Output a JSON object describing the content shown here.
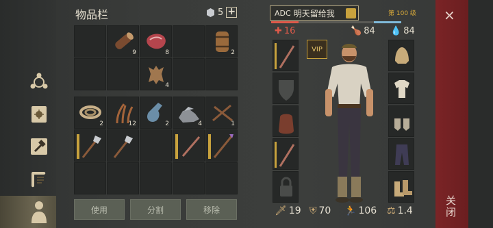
{
  "inventory": {
    "title": "物品栏",
    "coin_count": "5",
    "add_symbol": "+",
    "quantities": {
      "log": "9",
      "meat": "8",
      "barrel": "2",
      "hide": "4",
      "rope": "2",
      "fiber": "12",
      "flask": "2",
      "ore": "4",
      "sticks": "1"
    },
    "buttons": {
      "use": "使用",
      "split": "分割",
      "remove": "移除"
    }
  },
  "character": {
    "name": "明天留给我",
    "tag": "ADC",
    "level": "第 100 级",
    "health": "16",
    "hunger": "84",
    "thirst": "84",
    "vip": "VIP",
    "attack": "19",
    "defense": "70",
    "speed": "106",
    "weight": "1.4"
  },
  "close": {
    "x": "×",
    "label": "关闭"
  },
  "colors": {
    "health": "#e05a4a",
    "food": "#d6b27a",
    "water": "#7fb9d8",
    "close_panel": "#7a2426"
  }
}
